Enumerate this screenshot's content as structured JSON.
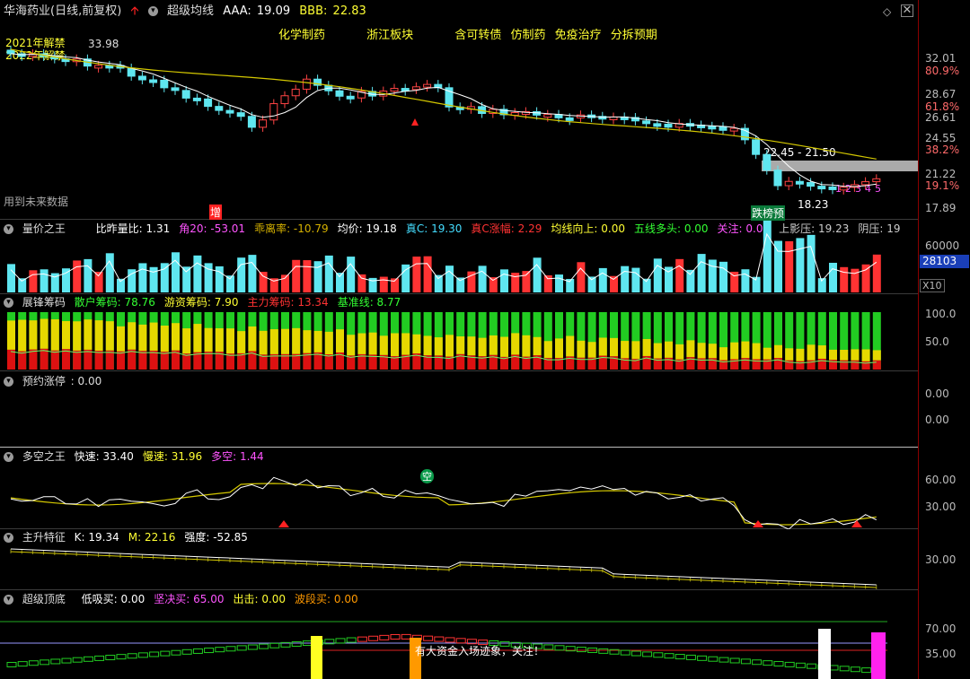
{
  "main": {
    "stock": "华海药业(日线,前复权)",
    "indicator": "超级均线",
    "aaa_label": "AAA:",
    "aaa": "19.09",
    "bbb_label": "BBB:",
    "bbb": "22.83",
    "tags": [
      "化学制药",
      "浙江板块",
      "含可转债",
      "仿制药",
      "免疫治疗",
      "分拆预期"
    ],
    "note_2021": "2021年解禁",
    "note_2022": "2022年解禁",
    "high_price": "33.98",
    "low_price": "18.23",
    "range_label": "22.45 - 21.50",
    "future_note": "用到未来数据",
    "zeng": "增",
    "drop_tag": "跌榜预",
    "counts": [
      "1",
      "2",
      "3",
      "4",
      "5"
    ],
    "price_ticks": [
      "32.01",
      "80.9%",
      "28.67",
      "61.8%",
      "26.61",
      "24.55",
      "38.2%",
      "21.22",
      "19.1%",
      "17.89"
    ]
  },
  "vol": {
    "title": "量价之王",
    "items": [
      {
        "label": "比昨量比:",
        "value": "1.31",
        "color": "#ffffff"
      },
      {
        "label": "角20:",
        "value": "-53.01",
        "color": "#ff55ff"
      },
      {
        "label": "乖离率:",
        "value": "-10.79",
        "color": "#d4b000"
      },
      {
        "label": "均价:",
        "value": "19.18",
        "color": "#ffffff"
      },
      {
        "label": "真C:",
        "value": "19.30",
        "color": "#44ddff"
      },
      {
        "label": "真C涨幅:",
        "value": "2.29",
        "color": "#ff3333"
      },
      {
        "label": "均线向上:",
        "value": "0.00",
        "color": "#ffff33"
      },
      {
        "label": "五线多头:",
        "value": "0.00",
        "color": "#33ff33"
      },
      {
        "label": "关注:",
        "value": "0.00",
        "color": "#ff55ff"
      },
      {
        "label": "上影压:",
        "value": "19.23",
        "color": "#cccccc"
      },
      {
        "label": "阴压:",
        "value": "19",
        "color": "#cccccc"
      }
    ],
    "ticks": [
      "60000"
    ],
    "current": "28103",
    "scale": "X10"
  },
  "chips": {
    "title": "展锋筹码",
    "items": [
      {
        "label": "散户筹码:",
        "value": "78.76",
        "color": "#33ff33"
      },
      {
        "label": "游资筹码:",
        "value": "7.90",
        "color": "#ffff33"
      },
      {
        "label": "主力筹码:",
        "value": "13.34",
        "color": "#ff3333"
      },
      {
        "label": "基准线:",
        "value": "8.77",
        "color": "#33ff33"
      }
    ],
    "ticks": [
      "100.0",
      "50.0"
    ]
  },
  "limit": {
    "title": "预约涨停",
    "value": ": 0.00",
    "ticks": [
      "0.00",
      "0.00"
    ]
  },
  "ls": {
    "title": "多空之王",
    "items": [
      {
        "label": "快速:",
        "value": "33.40",
        "color": "#ffffff"
      },
      {
        "label": "慢速:",
        "value": "31.96",
        "color": "#ffff33"
      },
      {
        "label": "多空:",
        "value": "1.44",
        "color": "#ff55ff"
      }
    ],
    "kong": "空",
    "ticks": [
      "60.00",
      "30.00"
    ]
  },
  "rise": {
    "title": "主升特征",
    "items": [
      {
        "label": "K:",
        "value": "19.34",
        "color": "#ffffff"
      },
      {
        "label": "M:",
        "value": "22.16",
        "color": "#ffff33"
      },
      {
        "label": "强度:",
        "value": "-52.85",
        "color": "#ffffff"
      }
    ],
    "ticks": [
      "30.00"
    ]
  },
  "top": {
    "title": "超级顶底",
    "items": [
      {
        "label": "低吸买:",
        "value": "0.00",
        "color": "#ffffff"
      },
      {
        "label": "坚决买:",
        "value": "65.00",
        "color": "#ff55ff"
      },
      {
        "label": "出击:",
        "value": "0.00",
        "color": "#ffff33"
      },
      {
        "label": "波段买:",
        "value": "0.00",
        "color": "#ff9900"
      }
    ],
    "note": "有大资金入场迹象，关注！",
    "ticks": [
      "70.00",
      "35.00"
    ]
  }
}
